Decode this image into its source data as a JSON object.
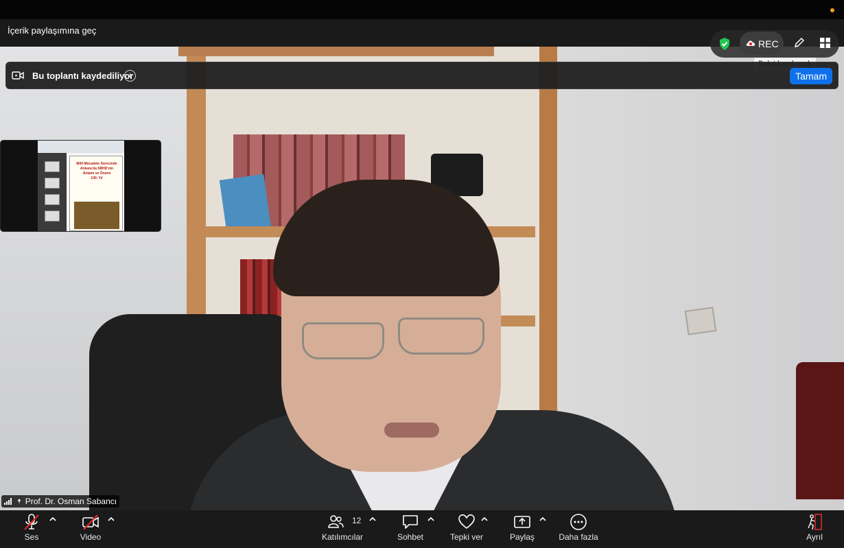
{
  "top": {
    "share_content": "İçerik paylaşımına geç"
  },
  "recording": {
    "banner_text": "Bu toplantı kaydediliyor",
    "info_symbol": "i",
    "ok_label": "Tamam",
    "rec_label": "REC",
    "tooltip": "Bulut kaydı açık"
  },
  "speaker": {
    "name": "Prof. Dr. Osman Sabancı"
  },
  "thumbnail": {
    "slide_title": "Millî Mücadele Sürecinde Ankara'da SBHD'nin Anlamı ve Önemi",
    "slide_subtitle": "100. Yıl"
  },
  "toolbar": {
    "audio": "Ses",
    "video": "Video",
    "participants": "Katılımcılar",
    "participants_count": "12",
    "chat": "Sohbet",
    "react": "Tepki ver",
    "share": "Paylaş",
    "more": "Daha fazla",
    "leave": "Ayrıl"
  },
  "colors": {
    "accent_blue": "#0e71eb",
    "leave_red": "#e02828",
    "shield_green": "#23c552",
    "mute_red": "#e02828"
  },
  "icons": [
    "camera-icon",
    "info-icon",
    "shield-icon",
    "cloud-icon",
    "pen-icon",
    "grid-icon",
    "signal-icon",
    "pin-icon",
    "microphone-muted-icon",
    "video-off-icon",
    "participants-icon",
    "chat-icon",
    "heart-icon",
    "share-screen-icon",
    "more-icon",
    "leave-icon",
    "chevron-up-icon"
  ]
}
